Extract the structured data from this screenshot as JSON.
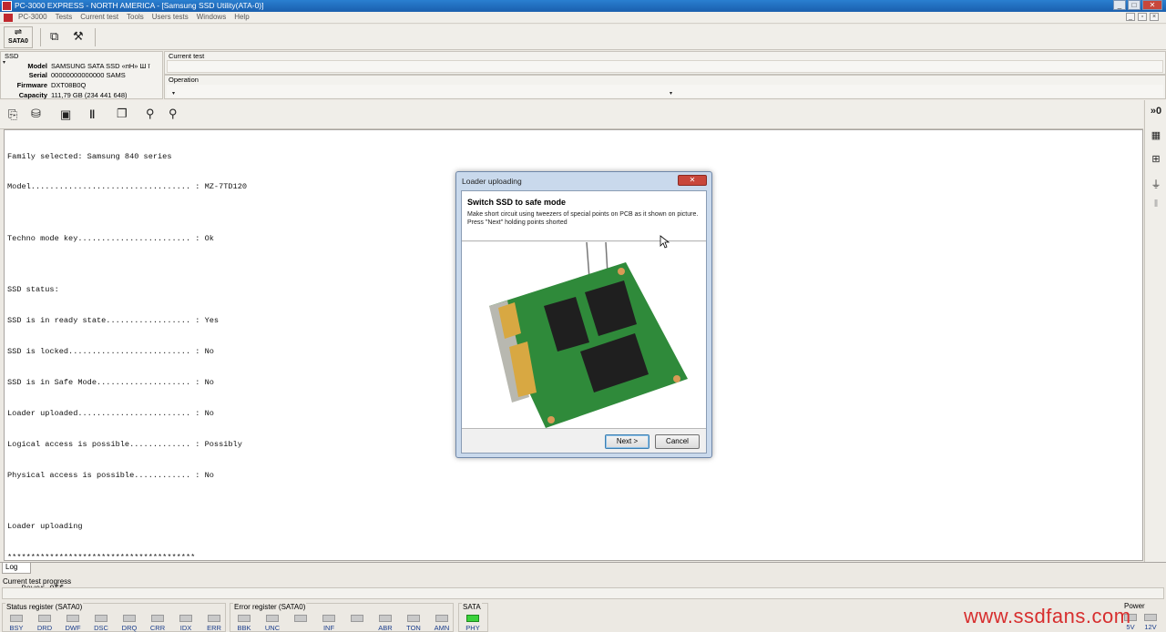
{
  "window": {
    "title": "PC-3000 EXPRESS - NORTH AMERICA - [Samsung SSD Utility(ATA-0)]",
    "minimize": "_",
    "maximize": "□",
    "close": "✕"
  },
  "menu": {
    "items": [
      "PC-3000",
      "Tests",
      "Current test",
      "Tools",
      "Users tests",
      "Windows",
      "Help"
    ],
    "mdi": [
      "_",
      "▫",
      "×"
    ]
  },
  "toolbar": {
    "sata_label": "SATA0"
  },
  "ssd": {
    "panel_title": "SSD",
    "rows": [
      {
        "key": "Model",
        "value": "SAMSUNG SATA SSD   «пН» Ш  ī"
      },
      {
        "key": "Serial",
        "value": "00000000000000  SAMS"
      },
      {
        "key": "Firmware",
        "value": "DXT08B0Q"
      },
      {
        "key": "Capacity",
        "value": "111,79 GB (234 441 648)"
      }
    ]
  },
  "current_test": {
    "label": "Current test"
  },
  "operation": {
    "label": "Operation"
  },
  "log": {
    "lines": [
      "Family selected: Samsung 840 series",
      "Model.................................. : MZ-7TD120",
      "",
      "Techno mode key........................ : Ok",
      "",
      "SSD status:",
      "SSD is in ready state.................. : Yes",
      "SSD is locked.......................... : No",
      "SSD is in Safe Mode.................... : No",
      "Loader uploaded........................ : No",
      "Logical access is possible............. : Possibly",
      "Physical access is possible............ : No",
      "",
      "Loader uploading",
      "****************************************",
      "   Power Off"
    ]
  },
  "tabs": {
    "log": "Log"
  },
  "progress": {
    "label": "Current test progress",
    "fraction": 0.0
  },
  "status_register": {
    "title": "Status register (SATA0)",
    "leds": [
      {
        "label": "BSY",
        "on": false
      },
      {
        "label": "DRD",
        "on": false
      },
      {
        "label": "DWF",
        "on": false
      },
      {
        "label": "DSC",
        "on": false
      },
      {
        "label": "DRQ",
        "on": false
      },
      {
        "label": "CRR",
        "on": false
      },
      {
        "label": "IDX",
        "on": false
      },
      {
        "label": "ERR",
        "on": false
      }
    ]
  },
  "error_register": {
    "title": "Error register (SATA0)",
    "leds": [
      {
        "label": "BBK",
        "on": false
      },
      {
        "label": "UNC",
        "on": false
      },
      {
        "label": "",
        "on": false
      },
      {
        "label": "INF",
        "on": false
      },
      {
        "label": "",
        "on": false
      },
      {
        "label": "ABR",
        "on": false
      },
      {
        "label": "TON",
        "on": false
      },
      {
        "label": "AMN",
        "on": false
      }
    ]
  },
  "sata": {
    "title": "SATA",
    "leds": [
      {
        "label": "PHY",
        "on": true
      }
    ]
  },
  "power": {
    "title": "Power",
    "leds": [
      {
        "label": "5V",
        "on": false
      },
      {
        "label": "12V",
        "on": false
      }
    ]
  },
  "watermark": "www.ssdfans.com",
  "dialog": {
    "title": "Loader uploading",
    "close": "✕",
    "heading": "Switch SSD to safe mode",
    "description": "Make short circuit using tweezers of special points on PCB as it shown on picture. Press \"Next\" holding points shorted",
    "next_button": "Next >",
    "cancel_button": "Cancel"
  },
  "colors": {
    "titlebar": "#1a5fae",
    "led_on": "#3bd23b",
    "led_off": "#c9c9c9",
    "watermark": "#d72e2e",
    "pcb_green": "#2f8a3a"
  },
  "icons": {
    "toolbar1": [
      "sata-port-icon",
      "copy-windows-icon",
      "tools-icon"
    ],
    "toolbar2": [
      "open-icon",
      "save-disk-icon",
      "save-icon",
      "pause-icon",
      "copy-icon",
      "search-icon",
      "search-next-icon"
    ],
    "right_bar": [
      "read-icon",
      "chip-icon",
      "circuit-icon",
      "plug-icon",
      "pause-icon"
    ]
  }
}
